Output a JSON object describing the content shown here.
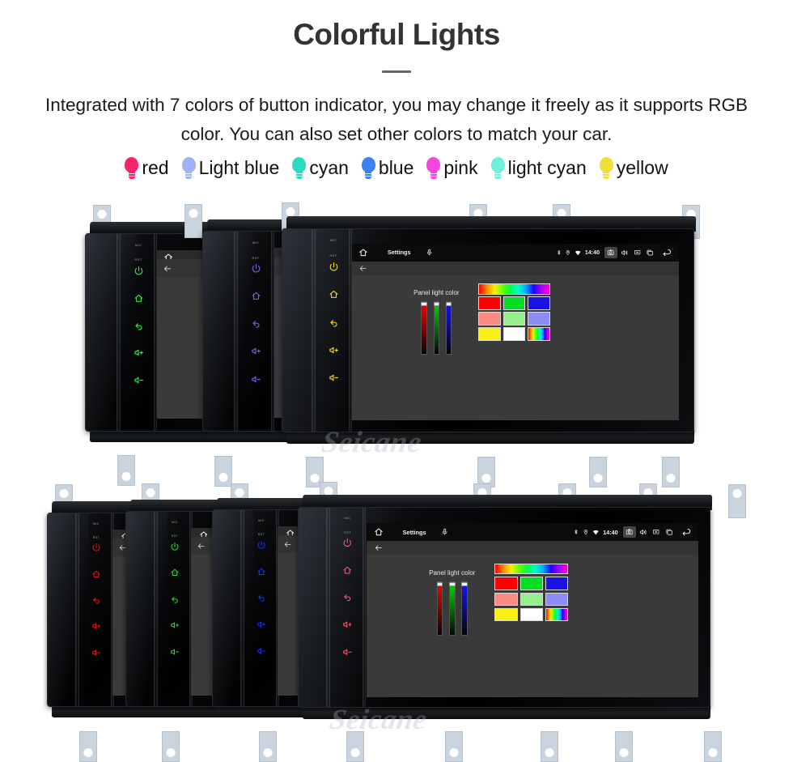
{
  "header": {
    "title": "Colorful Lights",
    "subtitle": "Integrated with 7 colors of button indicator, you may change it freely as it supports RGB color. You can also set other colors to match your car."
  },
  "legend": {
    "items": [
      {
        "label": "red",
        "color": "#f6246a"
      },
      {
        "label": "Light blue",
        "color": "#9fb2f7"
      },
      {
        "label": "cyan",
        "color": "#2ed9c3"
      },
      {
        "label": "blue",
        "color": "#3b82f0"
      },
      {
        "label": "pink",
        "color": "#f646e0"
      },
      {
        "label": "light cyan",
        "color": "#6ef2d9"
      },
      {
        "label": "yellow",
        "color": "#f0de3c"
      }
    ]
  },
  "device": {
    "rail_labels": {
      "mic": "MIC",
      "rst": "RST"
    },
    "rail_icons": [
      "power-icon",
      "home-icon",
      "back-icon",
      "volume-up-icon",
      "volume-down-icon"
    ],
    "screen": {
      "status_bar": {
        "home_icon": "home-icon",
        "title": "Settings",
        "mic_icon": "microphone-icon",
        "bluetooth_icon": "bluetooth-icon",
        "location_icon": "location-icon",
        "wifi_icon": "wifi-icon",
        "time": "14:40",
        "screenshot_icon": "camera-icon",
        "volume_icon": "speaker-icon",
        "close_icon": "close-box-icon",
        "recents_icon": "recents-icon",
        "back_icon": "back-arrow-icon"
      },
      "sub_bar": {
        "back_icon": "back-arrow-icon"
      },
      "picker": {
        "label": "Panel light color",
        "sliders": [
          {
            "name": "red-slider",
            "color": "#ff0000",
            "value": 100
          },
          {
            "name": "green-slider",
            "color": "#00dd00",
            "value": 100
          },
          {
            "name": "blue-slider",
            "color": "#1515ff",
            "value": 100
          }
        ],
        "spectrum_bar": "rainbow-spectrum",
        "swatches": [
          [
            "#ff0000",
            "#00dd22",
            "#1a12e0"
          ],
          [
            "#fa8a84",
            "#96ef8f",
            "#8c8cf5"
          ],
          [
            "#fbf014",
            "#ffffff",
            "rainbow"
          ]
        ]
      }
    }
  },
  "watermark": {
    "text": "Seicane"
  },
  "clusters": {
    "top": {
      "units": [
        {
          "button_color": "#2ee84a",
          "type": "blank"
        },
        {
          "button_color": "#7b5cf0",
          "type": "blank"
        },
        {
          "button_color": "#f5d612",
          "type": "settings"
        }
      ]
    },
    "bottom": {
      "units": [
        {
          "button_color": "#e81414",
          "type": "blank"
        },
        {
          "button_color": "#1fe02a",
          "type": "blank"
        },
        {
          "button_color": "#1a2ff0",
          "type": "blank"
        },
        {
          "button_color": "#f25a6e",
          "type": "settings"
        }
      ]
    }
  }
}
